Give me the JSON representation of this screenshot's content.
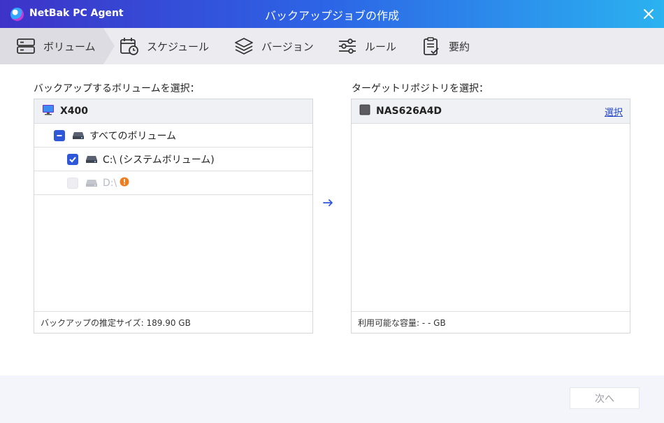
{
  "app": {
    "name": "NetBak PC Agent",
    "window_title": "バックアップジョブの作成",
    "close_icon": "close-icon",
    "accent_color": "#2f58d9"
  },
  "steps": [
    {
      "label": "ボリューム",
      "icon": "server-stack-icon",
      "active": true
    },
    {
      "label": "スケジュール",
      "icon": "calendar-clock-icon",
      "active": false
    },
    {
      "label": "バージョン",
      "icon": "layers-icon",
      "active": false
    },
    {
      "label": "ルール",
      "icon": "sliders-icon",
      "active": false
    },
    {
      "label": "要約",
      "icon": "clipboard-check-icon",
      "active": false
    }
  ],
  "source": {
    "label": "バックアップするボリュームを選択：",
    "device": {
      "name": "X400",
      "icon": "computer-monitor-icon"
    },
    "items": [
      {
        "label": "すべてのボリューム",
        "state": "partial",
        "icon": "drive-icon"
      },
      {
        "label": "C:\\ (システムボリューム)",
        "state": "checked",
        "icon": "drive-icon"
      },
      {
        "label": "D:\\",
        "state": "disabled",
        "icon": "drive-icon",
        "badge_icon": "warning-icon"
      }
    ],
    "footer": "バックアップの推定サイズ: 189.90 GB"
  },
  "arrow_icon": "arrow-right-icon",
  "target": {
    "label": "ターゲットリポジトリを選択：",
    "device": {
      "name": "NAS626A4D",
      "icon": "nas-icon"
    },
    "select_link": "選択",
    "footer": "利用可能な容量: - - GB"
  },
  "footer": {
    "next_label": "次へ"
  }
}
